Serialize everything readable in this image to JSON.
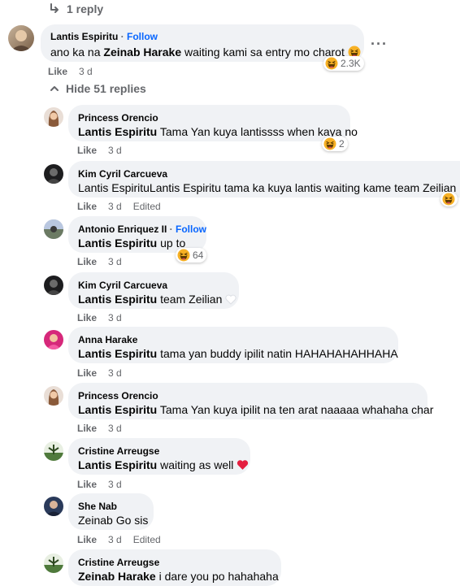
{
  "top_reply": {
    "icon": "reply-arrow-icon",
    "label": "1 reply"
  },
  "parent": {
    "author": "Lantis Espiritu",
    "follow_sep": " · ",
    "follow": "Follow",
    "text_pre": "ano ka na ",
    "mention": "Zeinab Harake",
    "text_post": " waiting kami sa entry mo charot",
    "reaction_count": "2.3K",
    "like": "Like",
    "time": "3 d"
  },
  "hide_replies": {
    "icon": "chevron-up-icon",
    "label": "Hide 51 replies"
  },
  "replies": [
    {
      "author": "Princess Orencio",
      "mention": "Lantis Espiritu",
      "text": " Tama Yan kuya lantissss when kaya no",
      "reaction_count": "2",
      "like": "Like",
      "time": "3 d"
    },
    {
      "author": "Kim Cyril Carcueva",
      "mention": "",
      "text": "Lantis EspirituLantis Espiritu tama ka kuya lantis waiting kame team Zeilian",
      "like": "Like",
      "time": "3 d",
      "edited": "Edited"
    },
    {
      "author": "Antonio Enriquez II",
      "follow_sep": " · ",
      "follow": "Follow",
      "mention": "Lantis Espiritu",
      "text": " up to",
      "reaction_count": "64",
      "like": "Like",
      "time": "3 d"
    },
    {
      "author": "Kim Cyril Carcueva",
      "mention": "Lantis Espiritu",
      "text": " team Zeilian",
      "like": "Like",
      "time": "3 d"
    },
    {
      "author": "Anna Harake",
      "mention": "Lantis Espiritu",
      "text": " tama yan buddy ipilit natin HAHAHAHAHHAHA",
      "like": "Like",
      "time": "3 d"
    },
    {
      "author": "Princess Orencio",
      "mention": "Lantis Espiritu",
      "text": " Tama Yan kuya ipilit na ten arat naaaaa whahaha char",
      "like": "Like",
      "time": "3 d"
    },
    {
      "author": "Cristine Arreugse",
      "mention": "Lantis Espiritu",
      "text": " waiting as well",
      "like": "Like",
      "time": "3 d"
    },
    {
      "author": "She Nab",
      "mention": "",
      "text": "Zeinab Go sis",
      "like": "Like",
      "time": "3 d",
      "edited": "Edited"
    },
    {
      "author": "Cristine Arreugse",
      "mention": "Zeinab Harake",
      "text": " i dare you po hahahaha"
    }
  ],
  "colors": {
    "secondary_text": "#65676b",
    "bubble": "#f0f2f5",
    "link": "#0866ff",
    "heart": "#e41e3f"
  }
}
